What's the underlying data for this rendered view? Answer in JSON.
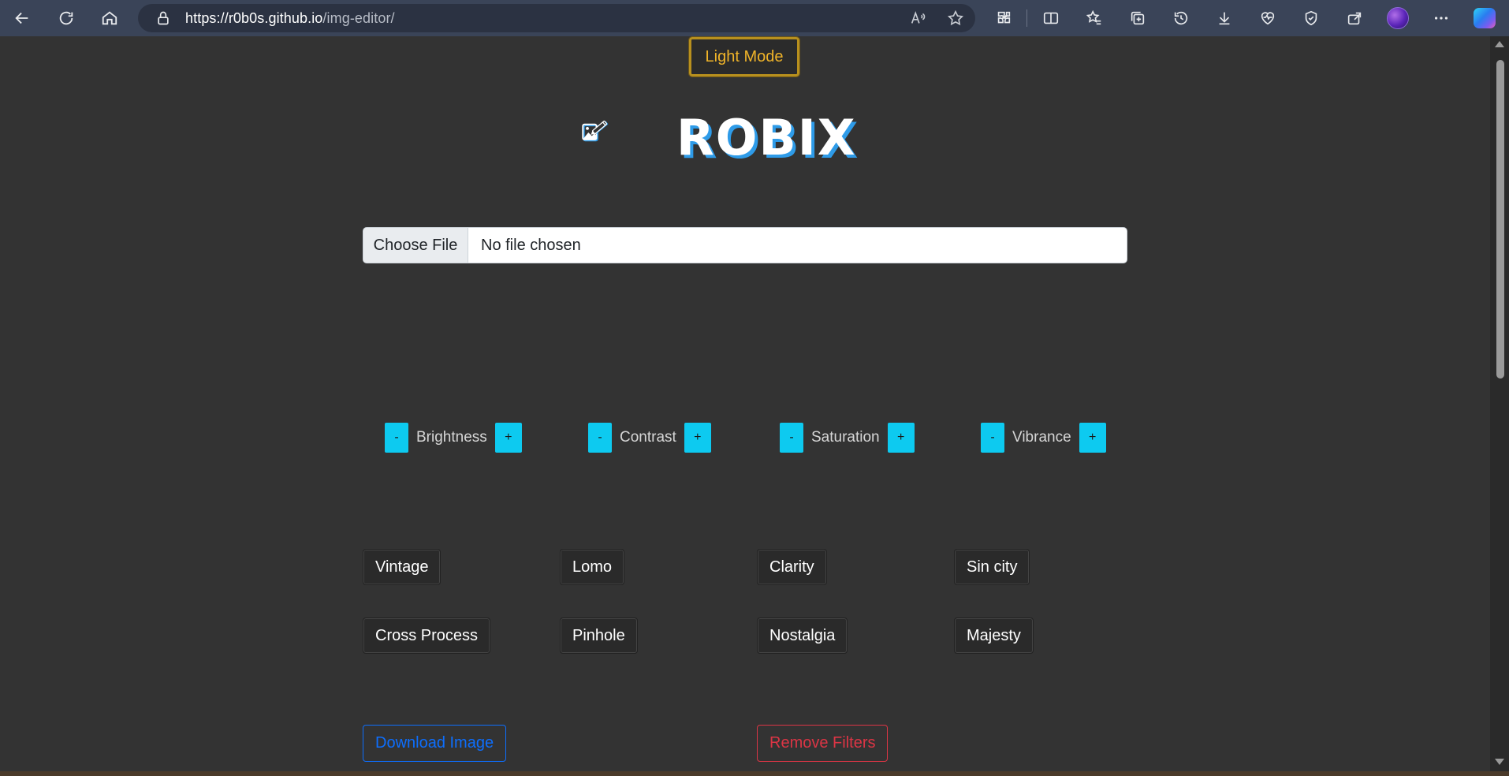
{
  "browser": {
    "url_host": "https://r0b0s.github.io",
    "url_path": "/img-editor/"
  },
  "header": {
    "theme_toggle_label": "Light Mode",
    "logo_text": "ROBIX"
  },
  "file_input": {
    "button_label": "Choose File",
    "status": "No file chosen"
  },
  "adjustments": [
    {
      "label": "Brightness",
      "minus": "-",
      "plus": "+"
    },
    {
      "label": "Contrast",
      "minus": "-",
      "plus": "+"
    },
    {
      "label": "Saturation",
      "minus": "-",
      "plus": "+"
    },
    {
      "label": "Vibrance",
      "minus": "-",
      "plus": "+"
    }
  ],
  "filters": [
    {
      "label": "Vintage"
    },
    {
      "label": "Lomo"
    },
    {
      "label": "Clarity"
    },
    {
      "label": "Sin city"
    },
    {
      "label": "Cross Process"
    },
    {
      "label": "Pinhole"
    },
    {
      "label": "Nostalgia"
    },
    {
      "label": "Majesty"
    }
  ],
  "actions": {
    "download_label": "Download Image",
    "remove_label": "Remove Filters"
  },
  "colors": {
    "page_bg": "#333333",
    "accent_cyan": "#0dcaf0",
    "warning": "#f0b429",
    "primary": "#0d6efd",
    "danger": "#dc3545"
  }
}
